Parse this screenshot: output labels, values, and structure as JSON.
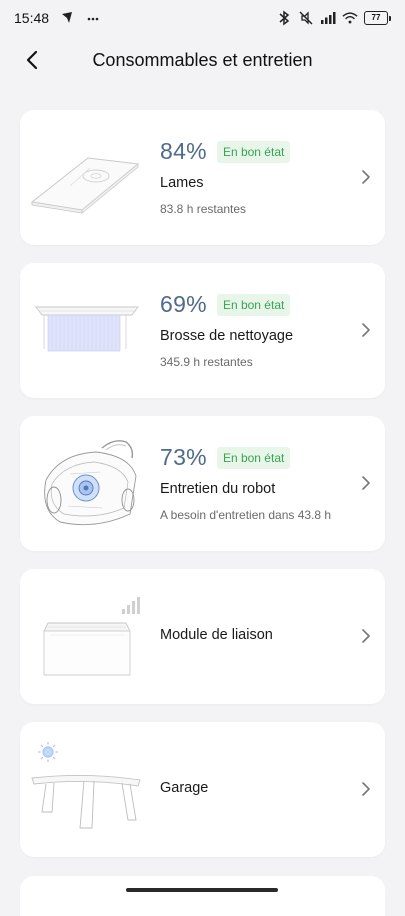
{
  "status_bar": {
    "time": "15:48",
    "left_icons": [
      "navigation-arrow-icon",
      "more-dots-icon"
    ],
    "right_icons": [
      "bluetooth-icon",
      "mute-icon",
      "signal-icon",
      "wifi-icon"
    ],
    "battery": "77"
  },
  "header": {
    "title": "Consommables et entretien",
    "back_icon": "chevron-left-icon"
  },
  "items": [
    {
      "percent": "84%",
      "badge": "En bon état",
      "name": "Lames",
      "subtitle": "83.8 h restantes",
      "illustration": "blade-plate-illustration"
    },
    {
      "percent": "69%",
      "badge": "En bon état",
      "name": "Brosse de nettoyage",
      "subtitle": "345.9 h restantes",
      "illustration": "cleaning-brush-illustration"
    },
    {
      "percent": "73%",
      "badge": "En bon état",
      "name": "Entretien du robot",
      "subtitle": "A besoin d'entretien dans 43.8 h",
      "illustration": "robot-mower-illustration"
    },
    {
      "name": "Module de liaison",
      "illustration": "link-module-illustration"
    },
    {
      "name": "Garage",
      "illustration": "garage-illustration"
    }
  ],
  "colors": {
    "background": "#f3f3f5",
    "card": "#ffffff",
    "percent_text": "#4f6b8a",
    "badge_bg": "#e8f6ea",
    "badge_text": "#3aa254"
  }
}
